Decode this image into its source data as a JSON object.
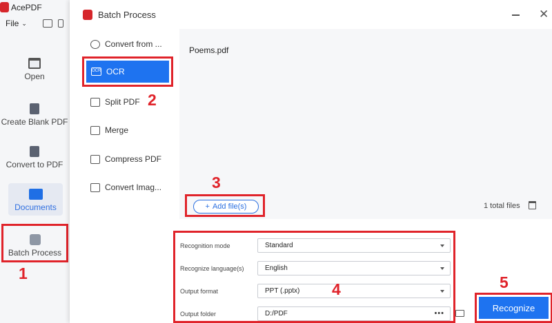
{
  "app": {
    "title": "AcePDF",
    "file_menu": "File"
  },
  "nav": {
    "open": "Open",
    "create_blank": "Create Blank PDF",
    "convert_to_pdf": "Convert to PDF",
    "documents": "Documents",
    "batch_process": "Batch Process"
  },
  "dialog": {
    "title": "Batch Process",
    "tools": {
      "convert_from": "Convert from ...",
      "ocr": "OCR",
      "ocr_icon_text": "OCR",
      "split": "Split PDF",
      "merge": "Merge",
      "compress": "Compress PDF",
      "convert_image": "Convert Imag..."
    },
    "files": [
      "Poems.pdf"
    ],
    "add_files": "Add file(s)",
    "total_files": "1 total files",
    "options": {
      "mode_label": "Recognition mode",
      "mode_value": "Standard",
      "language_label": "Recognize language(s)",
      "language_value": "English",
      "format_label": "Output format",
      "format_value": "PPT (.pptx)",
      "folder_label": "Output folder",
      "folder_value": "D:/PDF",
      "folder_dots": "•••"
    },
    "recognize": "Recognize"
  },
  "annotations": {
    "n1": "1",
    "n2": "2",
    "n3": "3",
    "n4": "4",
    "n5": "5"
  },
  "colors": {
    "accent": "#1e73f0",
    "highlight": "#e0232a",
    "brand": "#d6262b"
  }
}
